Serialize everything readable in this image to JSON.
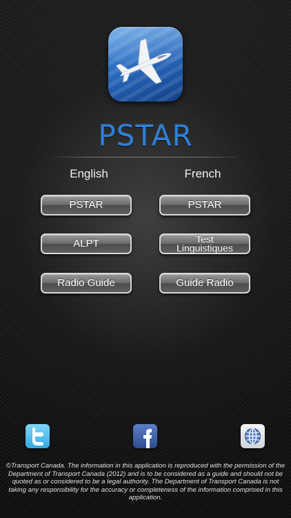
{
  "app": {
    "title": "PSTAR"
  },
  "columns": {
    "left_label": "English",
    "right_label": "French"
  },
  "buttons": {
    "english": [
      {
        "label": "PSTAR"
      },
      {
        "label": "ALPT"
      },
      {
        "label": "Radio Guide"
      }
    ],
    "french": [
      {
        "label": "PSTAR"
      },
      {
        "label": "Test\nLinguistiques"
      },
      {
        "label": "Guide Radio"
      }
    ]
  },
  "social": {
    "icons": [
      "twitter-icon",
      "facebook-icon",
      "globe-icon"
    ],
    "twitter_color": "#33a9e3",
    "facebook_color": "#2c4c8f"
  },
  "colors": {
    "title_blue": "#2f7fd6",
    "app_icon_blue": "#2a6bc0",
    "background": "#111111",
    "button_border": "#d8d8d8"
  },
  "footer": {
    "disclaimer": "©Transport Canada. The information in this application is reproduced with the permission of the Department of Transport Canada (2012) and is to be considered as a guide and should not be quoted as or considered to be a legal authority. The Department of Transport Canada is not taking any responsibility for the accuracy or completeness of the information comprised in this application."
  }
}
